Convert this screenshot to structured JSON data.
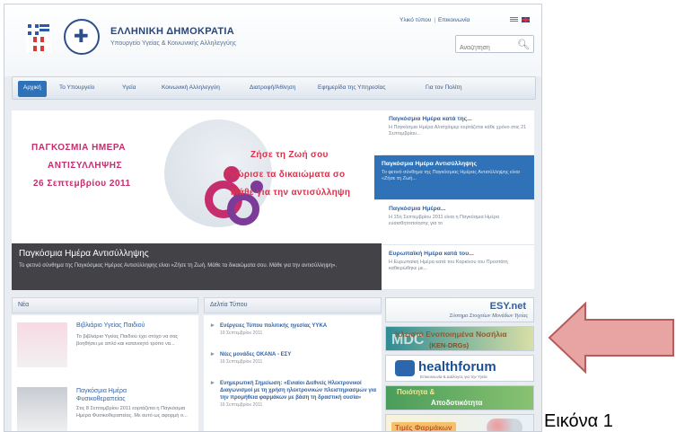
{
  "header": {
    "title": "ΕΛΛΗΝΙΚΗ ΔΗΜΟΚΡΑΤΙΑ",
    "subtitle": "Υπουργείο Υγείας & Κοινωνικής Αλληλεγγύης",
    "top_links": [
      "Υλικό τύπου",
      "Επικοινωνία"
    ],
    "search_placeholder": "Αναζήτηση"
  },
  "nav": {
    "items": [
      "Αρχική",
      "Το Υπουργείο",
      "Υγεία",
      "Κοινωνική Αλληλεγγύη",
      "Διατροφή/Άθληση",
      "Εφημερίδα της Υπηρεσίας",
      "Για τον Πολίτη"
    ]
  },
  "banner": {
    "line1": "ΠΑΓΚΟΣΜΙΑ ΗΜΕΡΑ",
    "line2": "ΑΝΤΙΣΥΛΛΗΨΗΣ",
    "line3": "26 Σεπτεμβρίου 2011",
    "slogan1": "Ζήσε τη Ζωή σου",
    "slogan2": "Γνώρισε τα δικαιώματα σο",
    "slogan3": "Μάθε για την αντισύλληψη",
    "caption_title": "Παγκόσμια Ημέρα Αντισύλληψης",
    "caption_text": "Το φετινό σύνθημα της Παγκόσμιας Ημέρας Αντισύλληψης είναι «Ζήσε τη Ζωή. Μάθε τα δικαιώματα σου. Μάθε για την αντισύλληψη»."
  },
  "features": [
    {
      "title": "Παγκόσμια Ημέρα κατά της...",
      "text": "Η Παγκόσμια Ημέρα Αλτσχάιμερ εορτάζεται κάθε χρόνο στις 21 Σεπτεμβρίου..."
    },
    {
      "title": "Παγκόσμια Ημέρα Αντισύλληψης",
      "text": "Το φετινό σύνθημα της Παγκόσμιας Ημέρας Αντισύλληψης είναι «Ζήσε τη Ζωή..."
    },
    {
      "title": "Παγκόσμια Ημέρα...",
      "text": "Η 15η Σεπτεμβρίου 2011 είναι η Παγκόσμια Ημέρα ευαισθητοποίησης για το"
    },
    {
      "title": "Ευρωπαϊκή Ημέρα κατά του...",
      "text": "Η Ευρωπαϊκή Ημέρα κατά του Καρκίνου του Προστάτη καθιερώθηκε με..."
    }
  ],
  "news": {
    "heading": "Νέα",
    "items": [
      {
        "title": "Βιβλιάριο Υγείας Παιδιού",
        "text": "Το βιβλιάριο Υγείας Παιδιού έχει στόχο να σας βοηθήσει με απλό και κατανοητό τρόπο να..."
      },
      {
        "title": "Παγκόσμια Ημέρα Φυσικοθεραπείας",
        "text": "Στις 8 Σεπτεμβρίου 2011 εορτάζεται η Παγκόσμια Ημέρα Φυσικοθεραπείας. Με αυτό ως αφορμή ο..."
      }
    ]
  },
  "press": {
    "heading": "Δελτία Τύπου",
    "items": [
      {
        "title": "Ενέργειες Τύπου πολιτικής ηγεσίας ΥΥΚΑ",
        "date": "19 Σεπτεμβρίου 2011"
      },
      {
        "title": "Νέες μονάδες ΟΚΑΝΑ - ΕΣΥ",
        "date": "16 Σεπτεμβρίου 2011"
      },
      {
        "title": "Ενημερωτική Σημείωση: «Ενιαίοι Διεθνείς Ηλεκτρονικοί Διαγωνισμοί με τη χρήση ηλεκτρονικών πλειστηριασμών για την προμήθεια φαρμάκων με βάση τη δραστική ουσία»",
        "date": "16 Σεπτεμβρίου 2011"
      }
    ]
  },
  "ads": {
    "esy_title": "ESY.net",
    "esy_sub": "Σύστημα Στοιχείων Μονάδων Υγείας",
    "drg_mdc": "MDC",
    "drg_title": "Κλειστά Ενοποιημένα Νοσήλια",
    "drg_sub": "(KEN-DRGs)",
    "hf_title": "healthforum",
    "hf_sub": "Επικοινωνία & Διάλογος για την Υγεία",
    "q_title1": "Ποιότητα &",
    "q_title2": "Αποδοτικότητα",
    "ph_title": "Τιμές Φαρμάκων"
  },
  "caption": "Εικόνα 1",
  "colors": {
    "accent": "#2f72b8",
    "arrow_fill": "#e8a3a3",
    "arrow_stroke": "#b65c5c"
  }
}
